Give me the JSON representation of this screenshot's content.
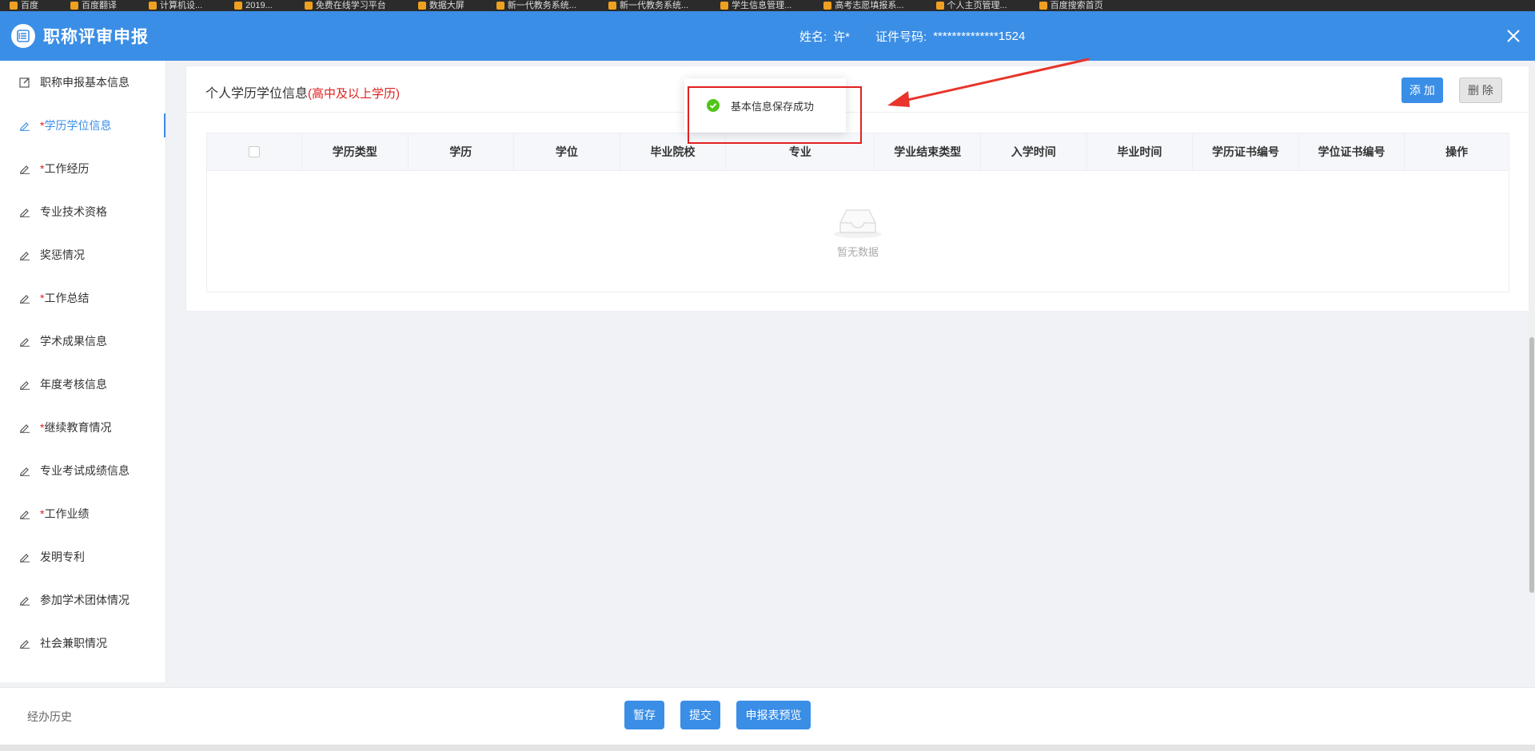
{
  "bookmarks": [
    "百度",
    "百度翻译",
    "计算机设...",
    "2019...",
    "免费在线学习平台",
    "数据大屏",
    "新一代教务系统...",
    "新一代教务系统...",
    "学生信息管理...",
    "高考志愿填报系...",
    "个人主页管理...",
    "百度搜索首页"
  ],
  "header": {
    "title": "职称评审申报",
    "name_label": "姓名:",
    "name_value": "许*",
    "id_label": "证件号码:",
    "id_value": "**************1524"
  },
  "sidebar": {
    "items": [
      {
        "label": "职称申报基本信息",
        "required": false,
        "icon": "edit-square-icon"
      },
      {
        "label": "学历学位信息",
        "required": true,
        "icon": "pencil-icon"
      },
      {
        "label": "工作经历",
        "required": true,
        "icon": "pencil-icon"
      },
      {
        "label": "专业技术资格",
        "required": false,
        "icon": "pencil-icon"
      },
      {
        "label": "奖惩情况",
        "required": false,
        "icon": "pencil-icon"
      },
      {
        "label": "工作总结",
        "required": true,
        "icon": "pencil-icon"
      },
      {
        "label": "学术成果信息",
        "required": false,
        "icon": "pencil-icon"
      },
      {
        "label": "年度考核信息",
        "required": false,
        "icon": "pencil-icon"
      },
      {
        "label": "继续教育情况",
        "required": true,
        "icon": "pencil-icon"
      },
      {
        "label": "专业考试成绩信息",
        "required": false,
        "icon": "pencil-icon"
      },
      {
        "label": "工作业绩",
        "required": true,
        "icon": "pencil-icon"
      },
      {
        "label": "发明专利",
        "required": false,
        "icon": "pencil-icon"
      },
      {
        "label": "参加学术团体情况",
        "required": false,
        "icon": "pencil-icon"
      },
      {
        "label": "社会兼职情况",
        "required": false,
        "icon": "pencil-icon"
      }
    ],
    "required_mark": "*"
  },
  "section": {
    "title": "个人学历学位信息",
    "note": "(高中及以上学历)",
    "add_label": "添 加",
    "delete_label": "删 除"
  },
  "table": {
    "columns": [
      "学历类型",
      "学历",
      "学位",
      "毕业院校",
      "专业",
      "学业结束类型",
      "入学时间",
      "毕业时间",
      "学历证书编号",
      "学位证书编号",
      "操作"
    ],
    "empty_text": "暂无数据"
  },
  "toast": {
    "message": "基本信息保存成功"
  },
  "footer": {
    "history_label": "经办历史",
    "save_label": "暂存",
    "submit_label": "提交",
    "preview_label": "申报表预览"
  },
  "colors": {
    "primary": "#3a8ee6",
    "required": "#e02020",
    "success": "#52c41a"
  }
}
